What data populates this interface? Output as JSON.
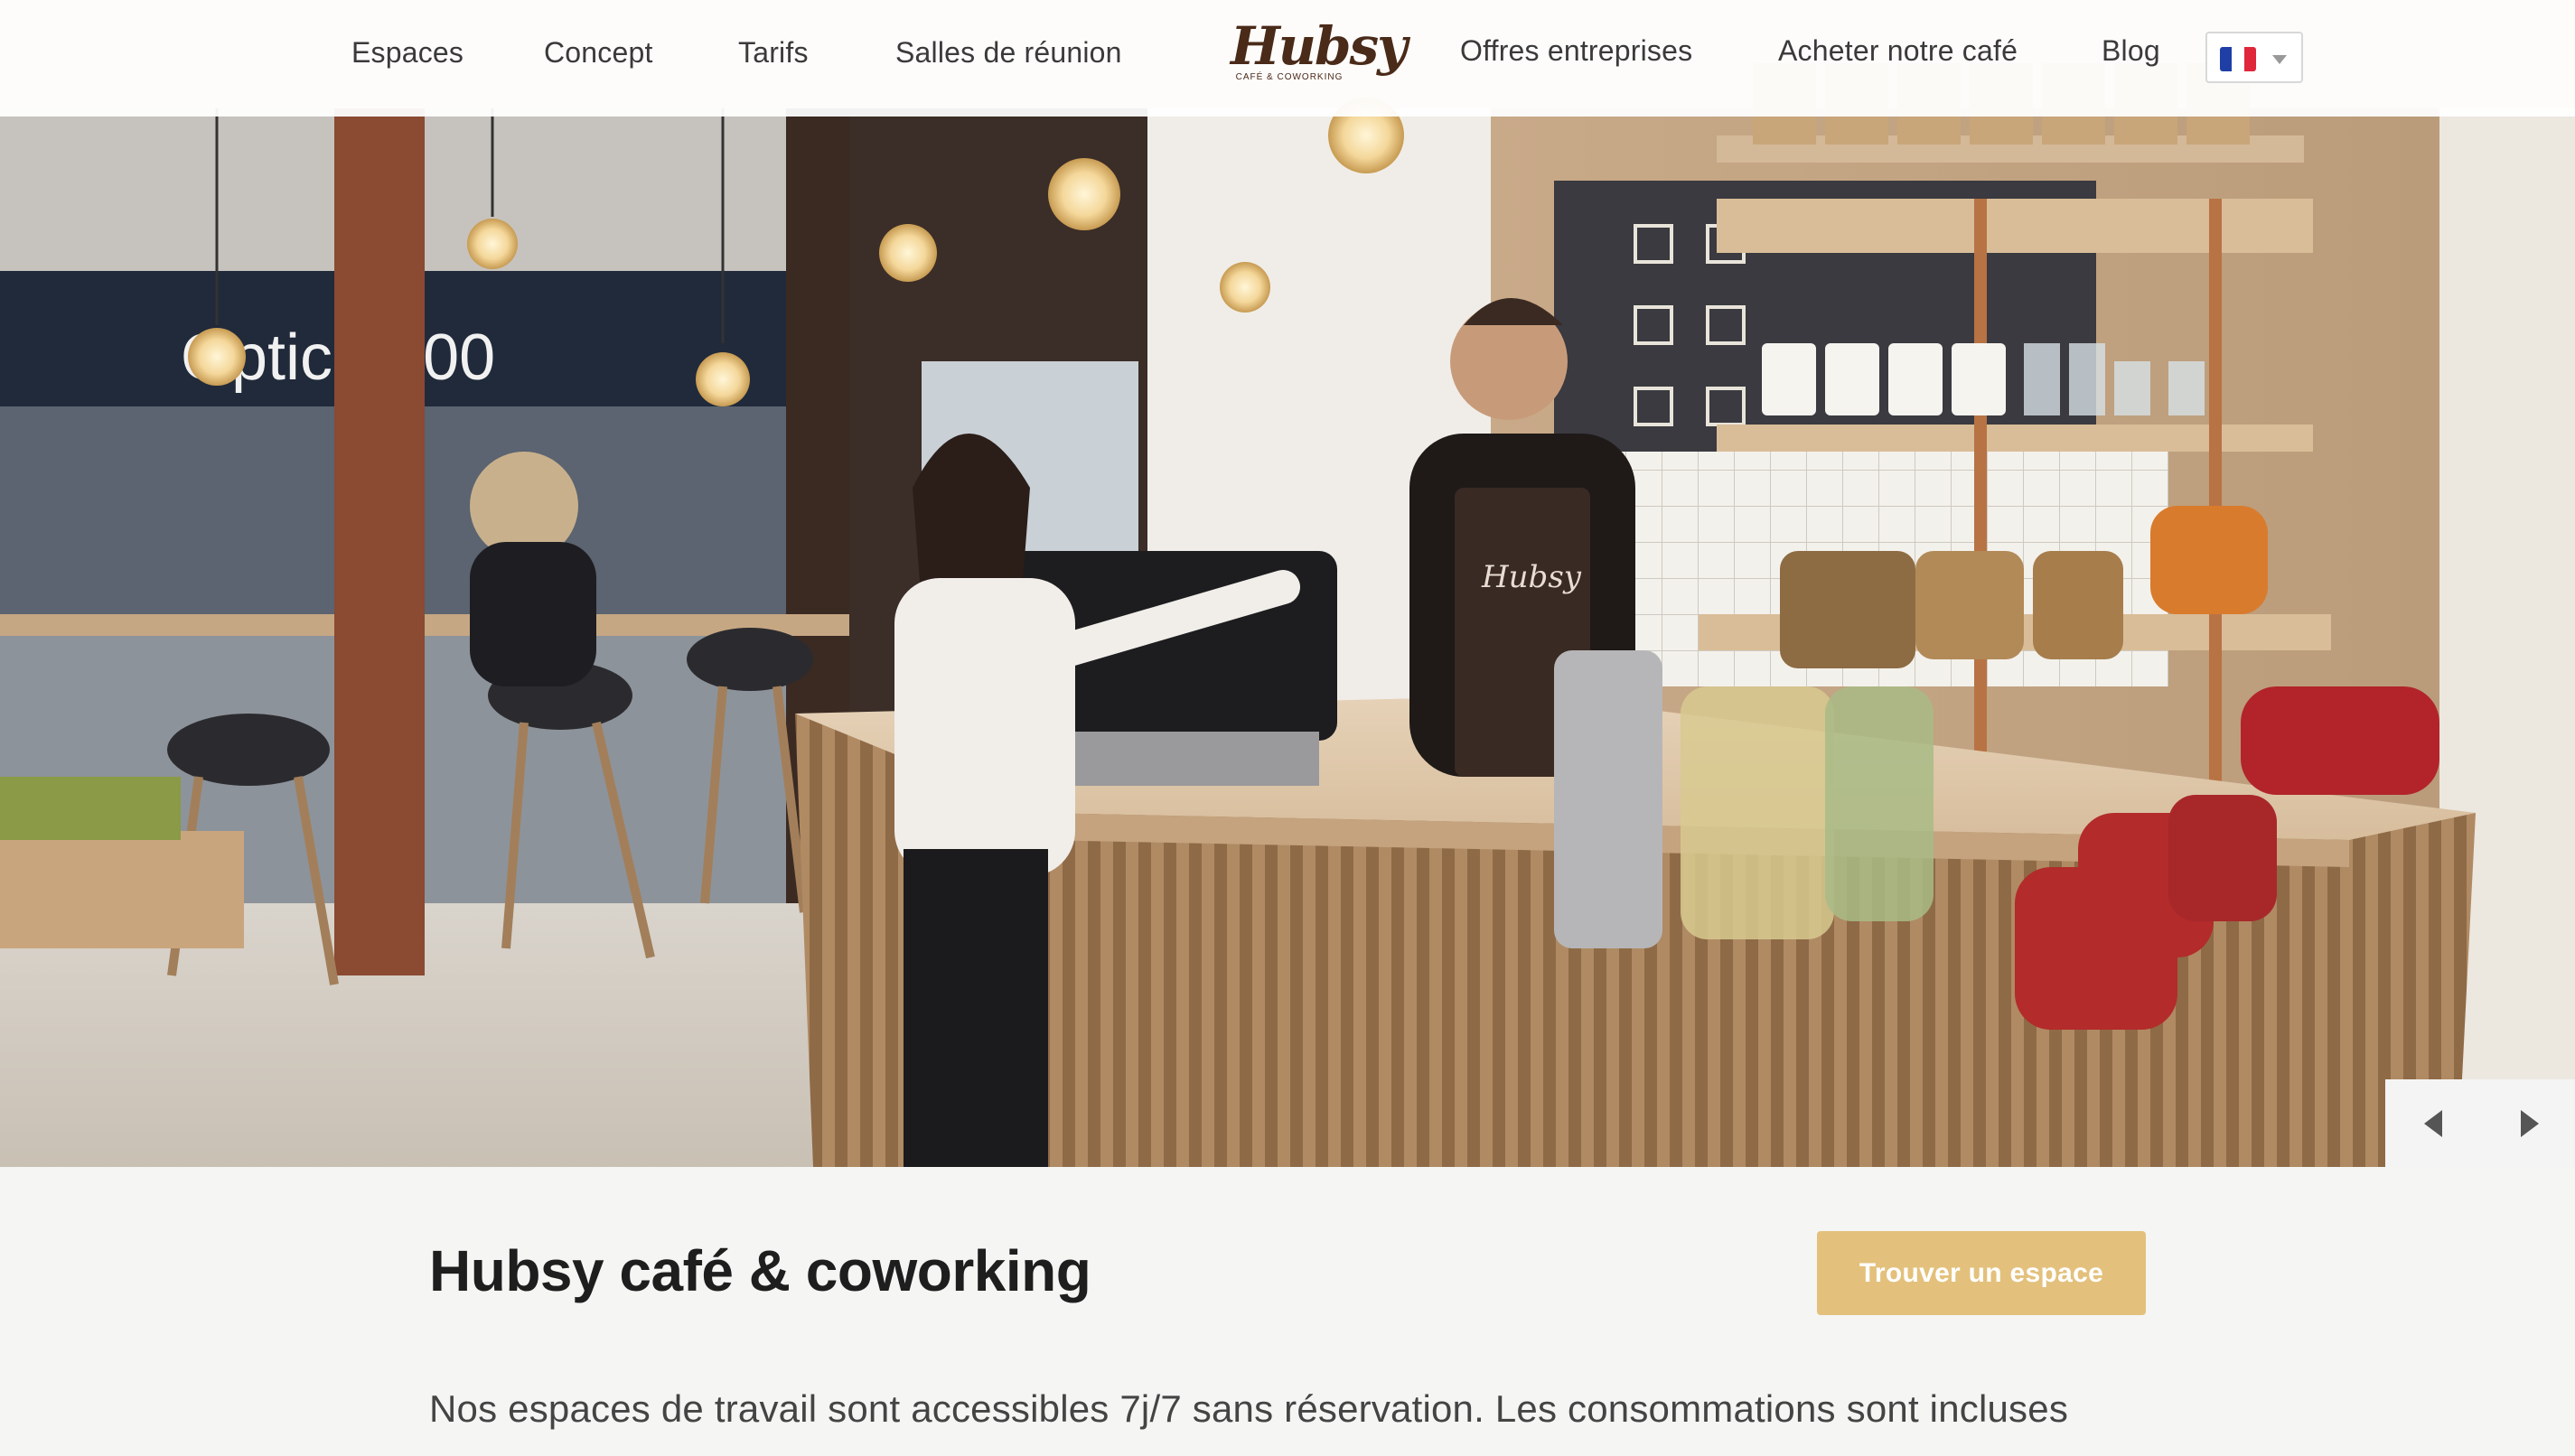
{
  "nav": {
    "left": [
      "Espaces",
      "Concept",
      "Tarifs",
      "Salles de réunion"
    ],
    "right": [
      "Offres entreprises",
      "Acheter notre café",
      "Blog"
    ]
  },
  "logo": {
    "word": "Hubsy",
    "tagline": "CAFÉ & COWORKING"
  },
  "language": {
    "flag": "fr",
    "flag_colors": [
      "#1f3fa6",
      "#ffffff",
      "#e0263a"
    ]
  },
  "hero": {
    "image": "Hubsy café counter with barista and customer",
    "storefront_sign": "Optic 2000",
    "apron_text": "Hubsy"
  },
  "main": {
    "title": "Hubsy café & coworking",
    "cta_label": "Trouver un espace",
    "intro": "Nos espaces de travail sont accessibles 7j/7 sans réservation. Les consommations sont incluses"
  },
  "colors": {
    "accent": "#e3c17c",
    "brand": "#4a2a18"
  },
  "icons": {
    "prev": "chevron-left-icon",
    "next": "chevron-right-icon"
  }
}
